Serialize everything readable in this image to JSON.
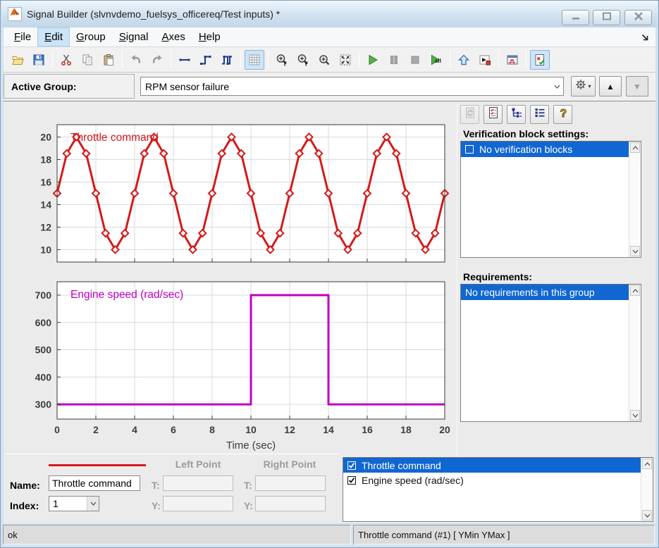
{
  "window": {
    "title": "Signal Builder (slvnvdemo_fuelsys_officereq/Test inputs) *"
  },
  "menu": {
    "items": [
      {
        "label": "File",
        "underline": 0,
        "highlighted": false
      },
      {
        "label": "Edit",
        "underline": 0,
        "highlighted": true
      },
      {
        "label": "Group",
        "underline": 0,
        "highlighted": false
      },
      {
        "label": "Signal",
        "underline": 0,
        "highlighted": false
      },
      {
        "label": "Axes",
        "underline": 0,
        "highlighted": false
      },
      {
        "label": "Help",
        "underline": 0,
        "highlighted": false
      }
    ]
  },
  "toolbar": {
    "groups": [
      [
        {
          "name": "open"
        },
        {
          "name": "save"
        }
      ],
      [
        {
          "name": "cut"
        },
        {
          "name": "copy"
        },
        {
          "name": "paste"
        }
      ],
      [
        {
          "name": "undo"
        },
        {
          "name": "redo"
        }
      ],
      [
        {
          "name": "line-mode"
        },
        {
          "name": "step-mode"
        },
        {
          "name": "pulse-mode"
        }
      ],
      [
        {
          "name": "grid",
          "toggled": true
        }
      ],
      [
        {
          "name": "zoom-t"
        },
        {
          "name": "zoom-y"
        },
        {
          "name": "zoom"
        },
        {
          "name": "fit-view"
        }
      ],
      [
        {
          "name": "run"
        },
        {
          "name": "pause",
          "disabled": true
        },
        {
          "name": "stop",
          "disabled": true
        },
        {
          "name": "run-all"
        }
      ],
      [
        {
          "name": "up"
        },
        {
          "name": "export-to-model"
        }
      ],
      [
        {
          "name": "scope"
        }
      ],
      [
        {
          "name": "verification-settings",
          "toggled": true
        }
      ]
    ]
  },
  "active_group": {
    "label": "Active Group:",
    "value": "RPM sensor failure"
  },
  "right_panel": {
    "tool_icons": [
      {
        "name": "sync",
        "disabled": true
      },
      {
        "name": "req-doc"
      },
      {
        "name": "tree-view"
      },
      {
        "name": "list-view"
      },
      {
        "name": "help"
      }
    ],
    "verification": {
      "label": "Verification block settings:",
      "items": [
        {
          "text": "No verification blocks",
          "checkbox": "unchecked",
          "selected": true
        }
      ]
    },
    "requirements": {
      "label": "Requirements:",
      "items": [
        {
          "text": "No requirements in this group",
          "selected": true
        }
      ]
    }
  },
  "signal_editor": {
    "name_label": "Name:",
    "name_value": "Throttle command",
    "index_label": "Index:",
    "index_value": "1",
    "left_point_label": "Left Point",
    "right_point_label": "Right Point",
    "t_label": "T:",
    "y_label": "Y:",
    "signal_color": "#d41a1a"
  },
  "signal_list": {
    "items": [
      {
        "text": "Throttle command",
        "checked": true,
        "selected": true
      },
      {
        "text": "Engine speed (rad/sec)",
        "checked": true,
        "selected": false
      }
    ]
  },
  "status_bar": {
    "left": "ok",
    "right": "Throttle command (#1)  [ YMin YMax ]"
  },
  "chart_data": [
    {
      "type": "line",
      "label": "Throttle command",
      "color": "#d41a1a",
      "marker": "diamond",
      "x": [
        0,
        0.5,
        1,
        1.5,
        2,
        2.5,
        3,
        3.5,
        4,
        4.5,
        5,
        5.5,
        6,
        6.5,
        7,
        7.5,
        8,
        8.5,
        9,
        9.5,
        10,
        10.5,
        11,
        11.5,
        12,
        12.5,
        13,
        13.5,
        14,
        14.5,
        15,
        15.5,
        16,
        16.5,
        17,
        17.5,
        18,
        18.5,
        19,
        19.5,
        20
      ],
      "y": [
        15,
        18.54,
        20,
        18.54,
        15,
        11.46,
        10,
        11.46,
        15,
        18.54,
        20,
        18.54,
        15,
        11.46,
        10,
        11.46,
        15,
        18.54,
        20,
        18.54,
        15,
        11.46,
        10,
        11.46,
        15,
        18.54,
        20,
        18.54,
        15,
        11.46,
        10,
        11.46,
        15,
        18.54,
        20,
        18.54,
        15,
        11.46,
        10,
        11.46,
        15
      ],
      "xlim": [
        0,
        20
      ],
      "ylim": [
        8.9,
        21.1
      ],
      "yticks": [
        10,
        12,
        14,
        16,
        18,
        20
      ],
      "xticks": [
        0,
        2,
        4,
        6,
        8,
        10,
        12,
        14,
        16,
        18,
        20
      ],
      "x_tick_labels_visible": false,
      "xlabel": "",
      "grid": true
    },
    {
      "type": "line",
      "label": "Engine speed (rad/sec)",
      "color": "#c000c0",
      "marker": "none",
      "x": [
        0,
        10,
        10,
        14,
        14,
        20
      ],
      "y": [
        300,
        300,
        700,
        700,
        300,
        300
      ],
      "xlim": [
        0,
        20
      ],
      "ylim": [
        246,
        749
      ],
      "yticks": [
        300,
        400,
        500,
        600,
        700
      ],
      "xticks": [
        0,
        2,
        4,
        6,
        8,
        10,
        12,
        14,
        16,
        18,
        20
      ],
      "x_tick_labels_visible": true,
      "xlabel": "Time (sec)",
      "grid": true
    }
  ]
}
